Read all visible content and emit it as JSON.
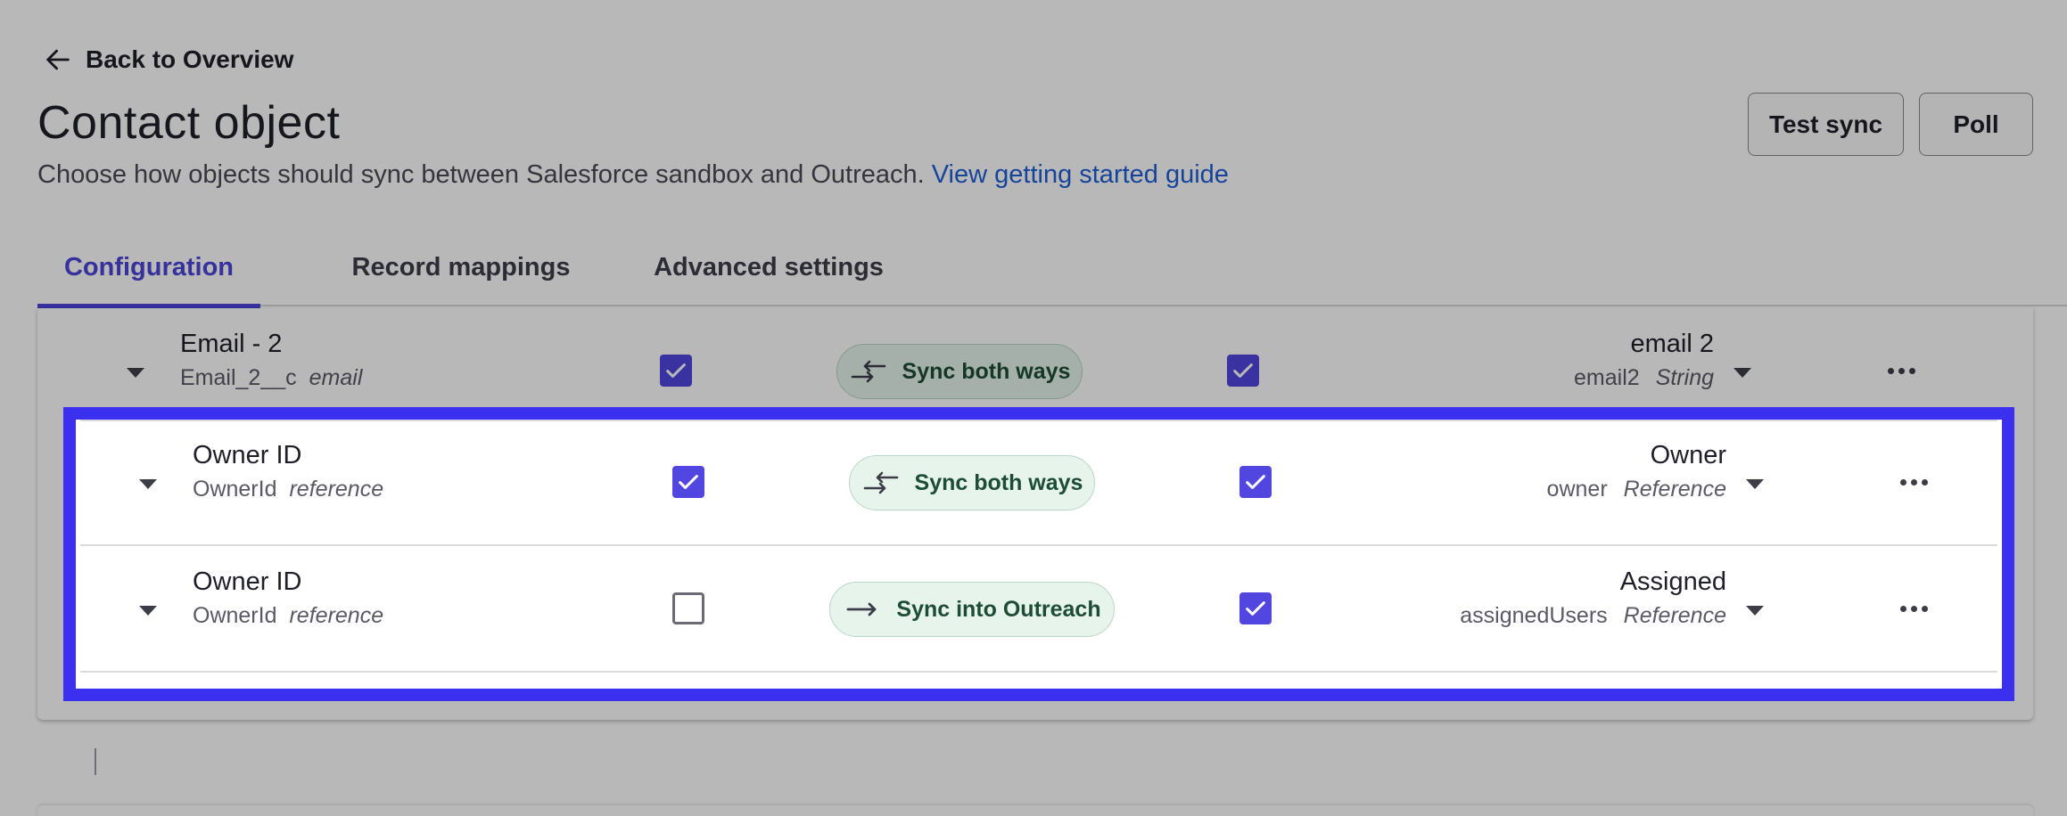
{
  "header": {
    "back_label": "Back to Overview",
    "title": "Contact object",
    "subtitle": "Choose how objects should sync between Salesforce sandbox and Outreach.",
    "guide_link": "View getting started guide",
    "test_sync_label": "Test sync",
    "poll_label": "Poll"
  },
  "tabs": [
    {
      "label": "Configuration",
      "active": true
    },
    {
      "label": "Record mappings",
      "active": false
    },
    {
      "label": "Advanced settings",
      "active": false
    }
  ],
  "rows": [
    {
      "name": "Email - 2",
      "api_name": "Email_2__c",
      "type": "email",
      "left_checked": true,
      "sync_label": "Sync both ways",
      "sync_icon": "bidirectional-arrows-icon",
      "right_checked": true,
      "target_name": "email 2",
      "target_api": "email2",
      "target_type": "String"
    },
    {
      "name": "Owner ID",
      "api_name": "OwnerId",
      "type": "reference",
      "left_checked": true,
      "sync_label": "Sync both ways",
      "sync_icon": "bidirectional-arrows-icon",
      "right_checked": true,
      "target_name": "Owner",
      "target_api": "owner",
      "target_type": "Reference"
    },
    {
      "name": "Owner ID",
      "api_name": "OwnerId",
      "type": "reference",
      "left_checked": false,
      "sync_label": "Sync into Outreach",
      "sync_icon": "right-arrow-icon",
      "right_checked": true,
      "target_name": "Assigned",
      "target_api": "assignedUsers",
      "target_type": "Reference"
    }
  ],
  "colors": {
    "accent": "#4b44d8",
    "highlight": "#3b2ff0",
    "pill_bg": "#e6f4ec",
    "pill_text": "#1d4d35",
    "checkbox": "#5146e0"
  }
}
